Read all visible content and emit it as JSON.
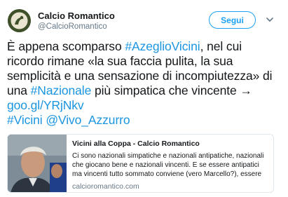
{
  "account": {
    "name": "Calcio Romantico",
    "handle": "@CalcioRomantico"
  },
  "follow_button": {
    "label": "Segui"
  },
  "tweet": {
    "seg1": "È appena scomparso ",
    "hashtag1": "#AzeglioVicini",
    "seg2": ", nel cui ricordo rimane «la sua faccia pulita, la sua semplicità e una sensazione di incompiutezza» di una ",
    "hashtag2": "#Nazionale",
    "seg3": " più simpatica che vincente → ",
    "link": "goo.gl/YRjNkv",
    "hashtag3": "#Vicini",
    "mention": "@Vivo_Azzurro"
  },
  "card": {
    "title": "Vicini alla Coppa - Calcio Romantico",
    "description": "Ci sono nazionali simpatiche e nazionali antipatiche, nazionali che giocano bene e nazionali vincenti. E se essere antipatici ma vincenti tutto sommato conviene (vero Marcello?), essere simp...",
    "domain": "calcioromantico.com"
  },
  "icons": {
    "avatar": "calcio-romantico-logo",
    "menu": "chevron-down-icon",
    "card_image": "portrait-photo"
  },
  "colors": {
    "link": "#1b95e0",
    "follow": "#1da1f2",
    "text": "#14171a",
    "muted": "#657786"
  }
}
